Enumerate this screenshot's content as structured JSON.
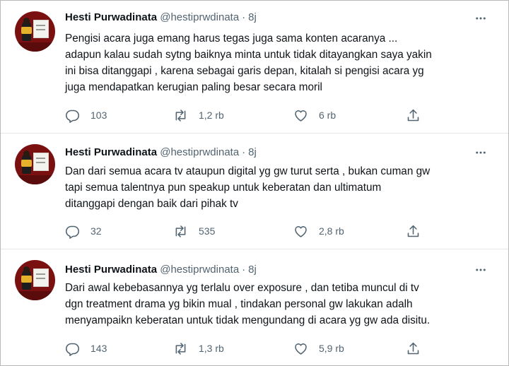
{
  "tweets": [
    {
      "name": "Hesti Purwadinata",
      "handle": "@hestiprwdinata",
      "separator": "·",
      "time": "8j",
      "lines": [
        "Pengisi acara juga emang harus tegas juga sama konten acaranya ...",
        "adapun kalau sudah sytng baiknya minta untuk tidak ditayangkan saya yakin",
        "ini bisa ditanggapi , karena sebagai garis depan, kitalah si pengisi acara yg",
        "juga mendapatkan kerugian paling besar secara moril"
      ],
      "replies": "103",
      "retweets": "1,2 rb",
      "likes": "6 rb"
    },
    {
      "name": "Hesti Purwadinata",
      "handle": "@hestiprwdinata",
      "separator": "·",
      "time": "8j",
      "lines": [
        "Dan dari semua acara tv ataupun digital yg gw turut serta , bukan cuman gw",
        "tapi semua talentnya pun speakup untuk keberatan dan ultimatum",
        "ditanggapi dengan baik dari pihak tv"
      ],
      "replies": "32",
      "retweets": "535",
      "likes": "2,8 rb"
    },
    {
      "name": "Hesti Purwadinata",
      "handle": "@hestiprwdinata",
      "separator": "·",
      "time": "8j",
      "lines": [
        "Dari awal kebebasannya yg terlalu over exposure , dan tetiba muncul di tv",
        "dgn treatment drama yg bikin mual , tindakan personal gw lakukan adalh",
        "menyampaikn keberatan untuk tidak mengundang di acara yg gw ada disitu."
      ],
      "replies": "143",
      "retweets": "1,3 rb",
      "likes": "5,9 rb"
    }
  ],
  "icons": {
    "reply": "reply-icon",
    "retweet": "retweet-icon",
    "like": "heart-icon",
    "share": "share-icon",
    "more": "more-icon"
  },
  "colors": {
    "text": "#0f1419",
    "secondary": "#536471",
    "divider": "#e6e6e6"
  }
}
